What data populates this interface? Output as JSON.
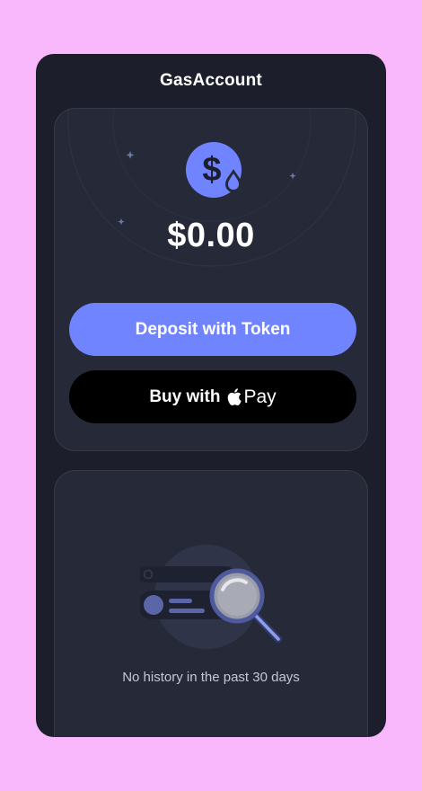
{
  "header": {
    "title": "GasAccount"
  },
  "balance": {
    "amount": "$0.00",
    "icon": "dollar-gas-drop-icon"
  },
  "actions": {
    "deposit_label": "Deposit with Token",
    "buy_label_prefix": "Buy with",
    "buy_label_suffix": "Pay",
    "buy_icon": "apple-logo-icon"
  },
  "history": {
    "empty_message": "No history in the past 30 days",
    "empty_icon": "magnifier-empty-list-icon"
  },
  "colors": {
    "page_bg": "#f9b8fb",
    "app_bg": "#1c1e2b",
    "card_bg": "#262a38",
    "accent": "#7084ff",
    "apple_pay_bg": "#000000"
  }
}
